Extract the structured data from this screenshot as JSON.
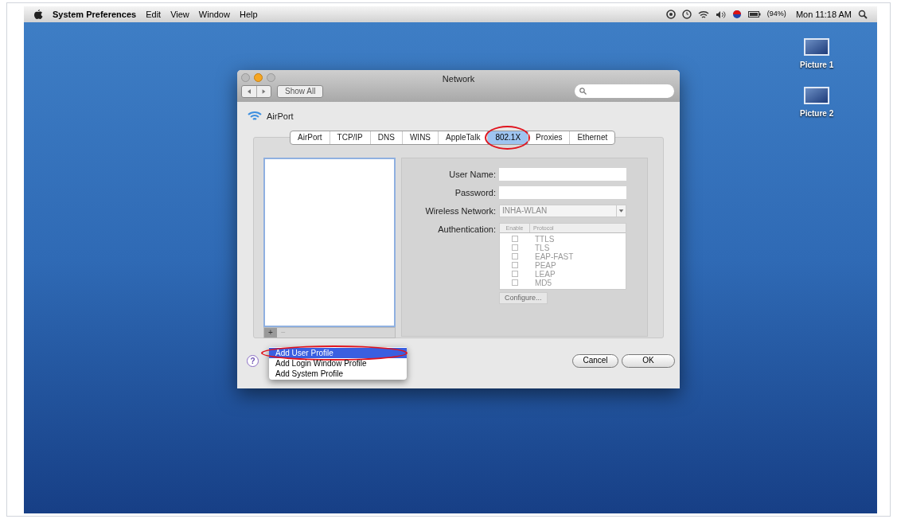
{
  "menubar": {
    "items": [
      {
        "label": "System Preferences",
        "kind": "app"
      },
      {
        "label": "Edit",
        "kind": "menu"
      },
      {
        "label": "View",
        "kind": "menu"
      },
      {
        "label": "Window",
        "kind": "menu"
      },
      {
        "label": "Help",
        "kind": "menu"
      }
    ],
    "battery": "(94%)",
    "clock": "Mon 11:18 AM"
  },
  "desktop_icons": [
    {
      "label": "Picture 1"
    },
    {
      "label": "Picture 2"
    }
  ],
  "window": {
    "title": "Network",
    "show_all": "Show All",
    "interface": "AirPort",
    "tabs": [
      {
        "label": "AirPort",
        "selected": false,
        "circled": false
      },
      {
        "label": "TCP/IP",
        "selected": false,
        "circled": false
      },
      {
        "label": "DNS",
        "selected": false,
        "circled": false
      },
      {
        "label": "WINS",
        "selected": false,
        "circled": false
      },
      {
        "label": "AppleTalk",
        "selected": false,
        "circled": false
      },
      {
        "label": "802.1X",
        "selected": true,
        "circled": true
      },
      {
        "label": "Proxies",
        "selected": false,
        "circled": false
      },
      {
        "label": "Ethernet",
        "selected": false,
        "circled": false
      }
    ],
    "user_name": {
      "label": "User Name:"
    },
    "password": {
      "label": "Password:"
    },
    "wireless_network": {
      "label": "Wireless Network:",
      "value": "INHA-WLAN"
    },
    "authentication": {
      "label": "Authentication:",
      "columns": [
        "Enable",
        "Protocol"
      ],
      "rows": [
        {
          "protocol": "TTLS",
          "checked": false
        },
        {
          "protocol": "TLS",
          "checked": false
        },
        {
          "protocol": "EAP-FAST",
          "checked": false
        },
        {
          "protocol": "PEAP",
          "checked": false
        },
        {
          "protocol": "LEAP",
          "checked": false
        },
        {
          "protocol": "MD5",
          "checked": false
        }
      ]
    },
    "configure": "Configure...",
    "add": "+",
    "remove": "−",
    "popup_menu": [
      {
        "label": "Add User Profile",
        "selected": true,
        "circled": true
      },
      {
        "label": "Add Login Window Profile",
        "selected": false,
        "circled": false
      },
      {
        "label": "Add System Profile",
        "selected": false,
        "circled": false
      }
    ],
    "help": "?",
    "buttons": [
      "Cancel",
      "OK"
    ]
  }
}
